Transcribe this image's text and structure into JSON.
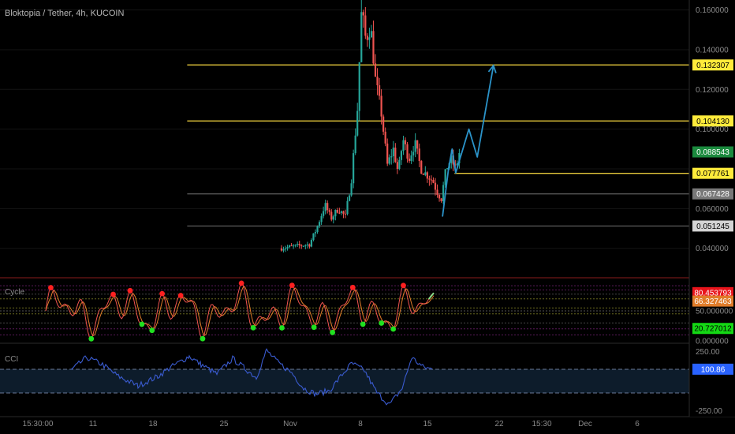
{
  "header": {
    "title": "Bloktopia / Tether, 4h, KUCOIN"
  },
  "colors": {
    "background": "#000000",
    "candle_up": "#26a69a",
    "candle_down": "#ef5350",
    "level_line": "#e6c93c",
    "projection": "#2b93c9",
    "stoch_k": "#ef5350",
    "stoch_d": "#e07c2a",
    "cci_line": "#3a5bd0",
    "cci_band": "#0d1c2b"
  },
  "chart_data": [
    {
      "type": "candlestick",
      "name": "price",
      "ylim": [
        0.026,
        0.165
      ],
      "y_axis_ticks": [
        "0.160000",
        "0.140000",
        "0.120000",
        "0.100000",
        "0.060000",
        "0.040000"
      ],
      "x_axis_ticks": [
        "15:30:00",
        "11",
        "18",
        "25",
        "Nov",
        "8",
        "15",
        "22",
        "15:30",
        "Dec",
        "6"
      ],
      "price_badges": [
        {
          "label": "0.132307",
          "value": 0.132307,
          "bg": "#ffeb3b",
          "fg": "#000000"
        },
        {
          "label": "0.104130",
          "value": 0.10413,
          "bg": "#ffeb3b",
          "fg": "#000000"
        },
        {
          "label": "0.088543",
          "value": 0.088543,
          "bg": "#1b8a3e",
          "fg": "#ffffff"
        },
        {
          "label": "0.077761",
          "value": 0.077761,
          "bg": "#ffeb3b",
          "fg": "#000000"
        },
        {
          "label": "0.067428",
          "value": 0.067428,
          "bg": "#787878",
          "fg": "#ffffff"
        },
        {
          "label": "0.051245",
          "value": 0.051245,
          "bg": "#d4d4d4",
          "fg": "#000000"
        }
      ],
      "horizontal_levels": [
        {
          "value": 0.132307,
          "color": "#e6c93c",
          "from_day": -8.2
        },
        {
          "value": 0.10413,
          "color": "#e6c93c",
          "from_day": -8.2
        },
        {
          "value": 0.077761,
          "color": "#e6c93c",
          "from_day": 14.1
        },
        {
          "value": 0.067428,
          "color": "#555555",
          "from_day": -8.2
        },
        {
          "value": 0.051245,
          "color": "#555555",
          "from_day": -8.2
        }
      ],
      "close_path": [
        [
          -0.5,
          0.04
        ],
        [
          2.0,
          0.042
        ],
        [
          2.6,
          0.05
        ],
        [
          3.3,
          0.062
        ],
        [
          3.8,
          0.055
        ],
        [
          4.4,
          0.06
        ],
        [
          5.0,
          0.056
        ],
        [
          5.5,
          0.075
        ],
        [
          6.0,
          0.11
        ],
        [
          6.35,
          0.16
        ],
        [
          6.7,
          0.145
        ],
        [
          7.1,
          0.152
        ],
        [
          7.5,
          0.125
        ],
        [
          8.0,
          0.108
        ],
        [
          8.5,
          0.082
        ],
        [
          9.0,
          0.09
        ],
        [
          9.4,
          0.078
        ],
        [
          9.8,
          0.095
        ],
        [
          10.3,
          0.085
        ],
        [
          10.8,
          0.093
        ],
        [
          11.3,
          0.08
        ],
        [
          11.8,
          0.077
        ],
        [
          12.3,
          0.074
        ],
        [
          12.6,
          0.069
        ],
        [
          13.0,
          0.065
        ],
        [
          13.4,
          0.08
        ],
        [
          13.8,
          0.085
        ],
        [
          14.2,
          0.08
        ],
        [
          14.5,
          0.088
        ]
      ],
      "projection_path": [
        [
          13.1,
          0.056
        ],
        [
          13.6,
          0.08
        ],
        [
          13.9,
          0.09
        ],
        [
          14.2,
          0.078
        ],
        [
          15.3,
          0.1
        ],
        [
          16.0,
          0.086
        ],
        [
          17.35,
          0.132
        ]
      ]
    },
    {
      "type": "line",
      "name": "stochastic",
      "indicator_label": "Cycle",
      "ylim": [
        0,
        100
      ],
      "y_axis_ticks": [
        "50.000000",
        "0.000000"
      ],
      "value_badges": [
        {
          "label": "80.453793",
          "value": 80.45,
          "bg": "#e8141b",
          "fg": "#ffffff"
        },
        {
          "label": "66.327463",
          "value": 66.33,
          "bg": "#e07c2a",
          "fg": "#ffffff"
        },
        {
          "label": "20.727012",
          "value": 20.73,
          "bg": "#14d814",
          "fg": "#000000"
        }
      ],
      "guide_levels": [
        92,
        85,
        78,
        70,
        55,
        50,
        45,
        30,
        20,
        10
      ]
    },
    {
      "type": "line",
      "name": "cci",
      "indicator_label": "CCI",
      "ylim": [
        -280,
        300
      ],
      "y_axis_ticks": [
        "250.00",
        "-250.00"
      ],
      "band": [
        -100,
        100
      ],
      "value_badges": [
        {
          "label": "100.86",
          "value": 100.86,
          "bg": "#2962ff",
          "fg": "#ffffff"
        }
      ]
    }
  ]
}
